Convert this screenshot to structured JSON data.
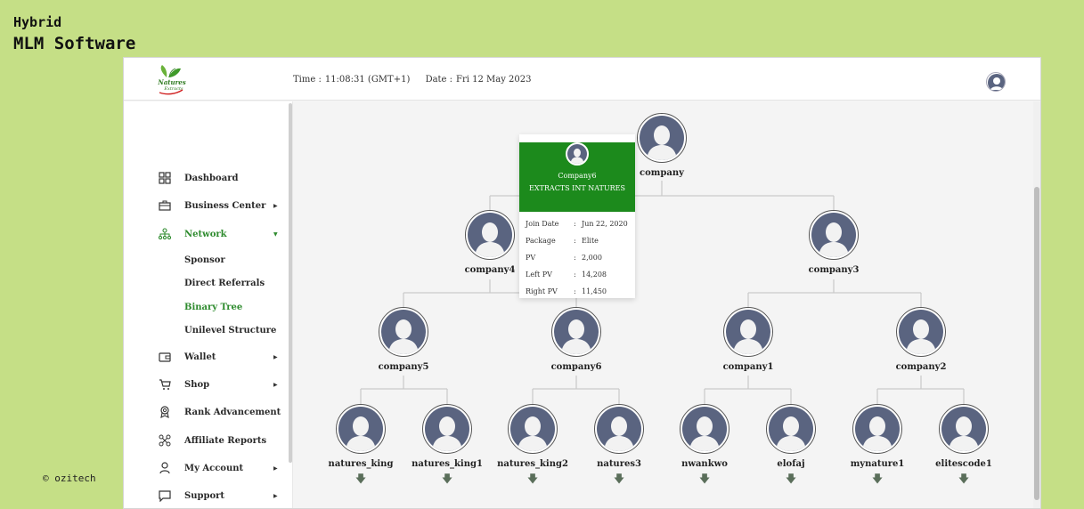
{
  "promo": {
    "line1": "Hybrid",
    "line2": "MLM Software",
    "credit": "© ozitech"
  },
  "header": {
    "logo_text": "Natures Extracts",
    "time_label": "Time :",
    "time_value": "11:08:31 (GMT+1)",
    "date_label": "Date :",
    "date_value": "Fri 12 May 2023"
  },
  "sidebar": {
    "items": [
      {
        "label": "Dashboard",
        "icon": "grid-icon",
        "caret": false
      },
      {
        "label": "Business Center",
        "icon": "briefcase-icon",
        "caret": true
      },
      {
        "label": "Network",
        "icon": "network-icon",
        "caret": true,
        "active": true
      },
      {
        "label": "Wallet",
        "icon": "wallet-icon",
        "caret": true
      },
      {
        "label": "Shop",
        "icon": "cart-icon",
        "caret": true
      },
      {
        "label": "Rank Advancement",
        "icon": "award-icon",
        "caret": false
      },
      {
        "label": "Affiliate Reports",
        "icon": "share-icon",
        "caret": false
      },
      {
        "label": "My Account",
        "icon": "user-icon",
        "caret": true
      },
      {
        "label": "Support",
        "icon": "chat-icon",
        "caret": true
      }
    ],
    "network_sub": [
      {
        "label": "Sponsor"
      },
      {
        "label": "Direct Referrals"
      },
      {
        "label": "Binary Tree",
        "active": true
      },
      {
        "label": "Unilevel Structure"
      }
    ]
  },
  "tree": {
    "root": "company",
    "level1": [
      "company4",
      "company3"
    ],
    "level2": [
      "company5",
      "company6",
      "company1",
      "company2"
    ],
    "level3": [
      "natures_king",
      "natures_king1",
      "natures_king2",
      "natures3",
      "nwankwo",
      "elofaj",
      "mynature1",
      "elitescode1"
    ],
    "expand_icon": "arrow-down-icon"
  },
  "popup": {
    "username": "Company6",
    "fullname": "EXTRACTS INT NATURES",
    "rows": [
      {
        "key": "Join Date",
        "value": "Jun 22, 2020"
      },
      {
        "key": "Package",
        "value": "Elite"
      },
      {
        "key": "PV",
        "value": "2,000"
      },
      {
        "key": "Left PV",
        "value": "14,208"
      },
      {
        "key": "Right PV",
        "value": "11,450"
      }
    ]
  },
  "colors": {
    "page_bg": "#c5df86",
    "accent_green": "#1c8a1c",
    "active_text": "#2e8b2e",
    "avatar_fill": "#5a6480"
  }
}
